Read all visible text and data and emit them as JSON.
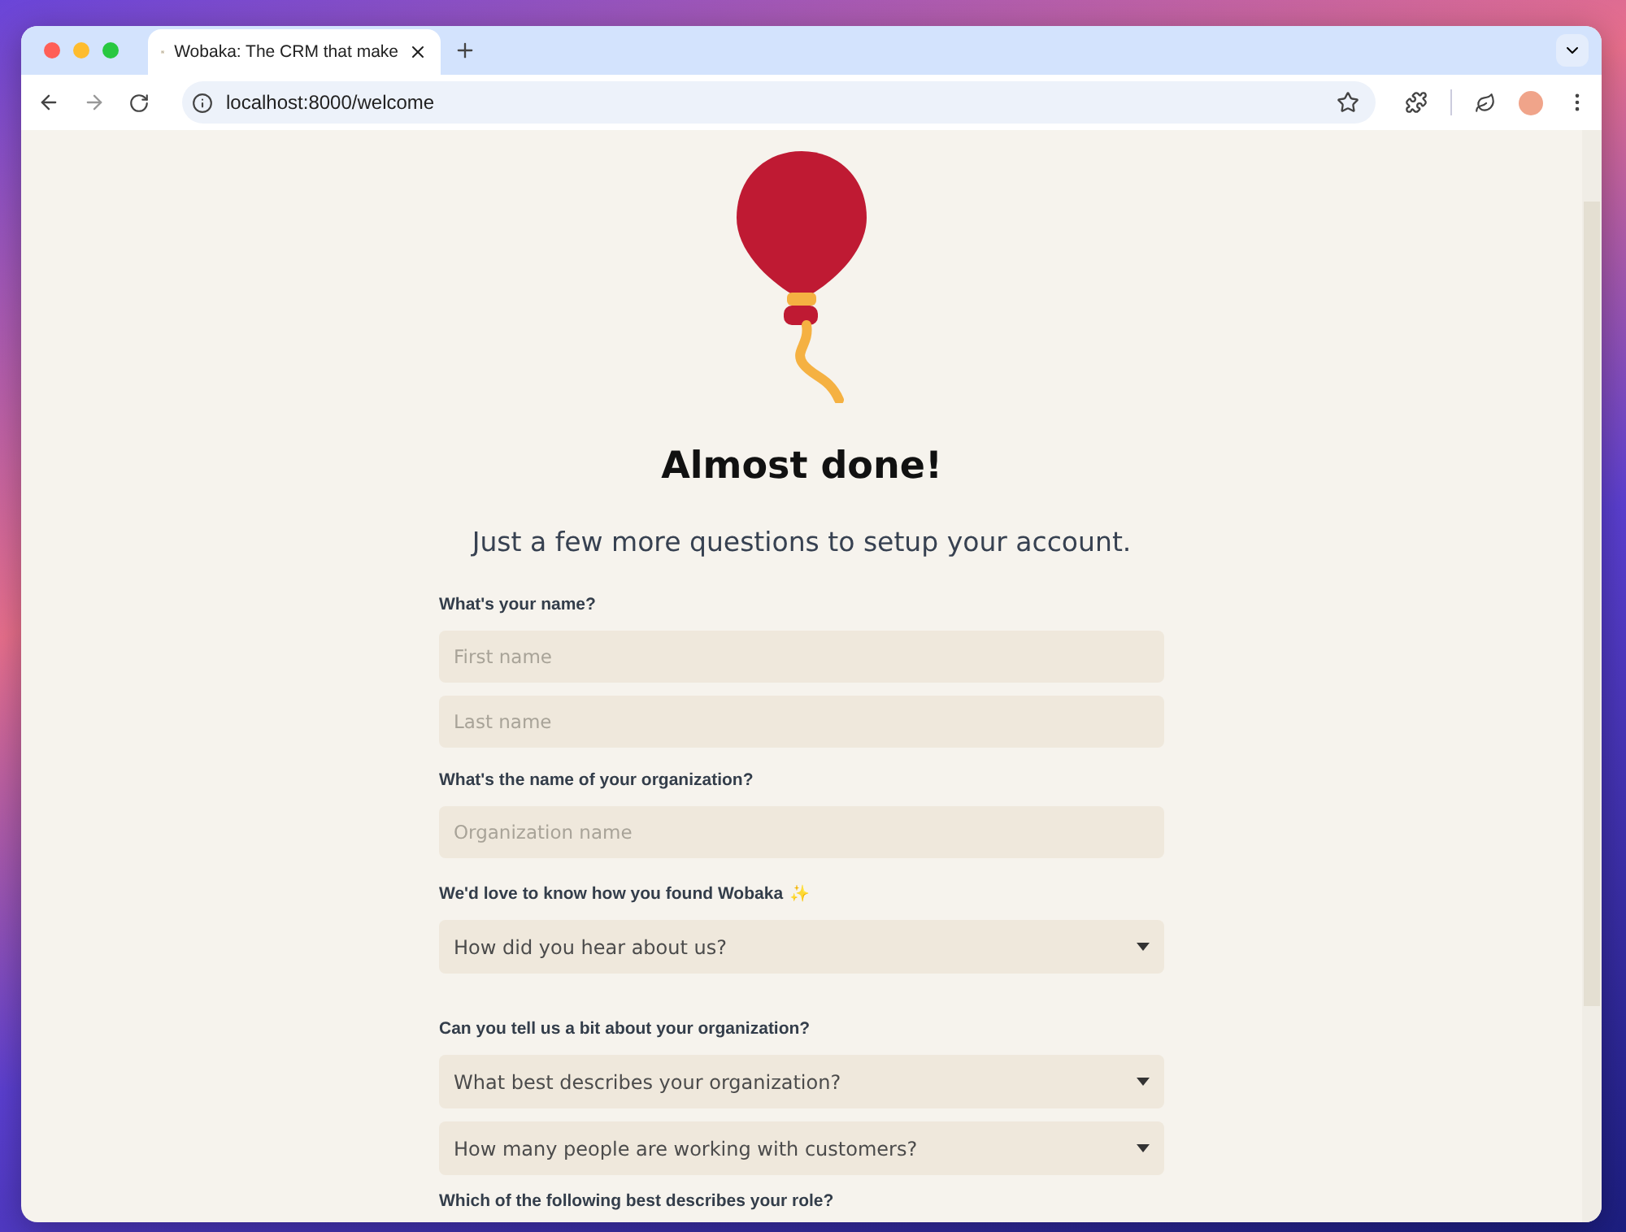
{
  "browser": {
    "tabs": [
      {
        "title": "Wobaka: The CRM that make",
        "selected": true
      }
    ],
    "url": "localhost:8000/welcome"
  },
  "page": {
    "heading": "Almost done!",
    "subtitle": "Just a few more questions to setup your account.",
    "sections": [
      {
        "label": "What's your name?",
        "fields": [
          {
            "kind": "text",
            "placeholder": "First name"
          },
          {
            "kind": "text",
            "placeholder": "Last name"
          }
        ]
      },
      {
        "label": "What's the name of your organization?",
        "fields": [
          {
            "kind": "text",
            "placeholder": "Organization name"
          }
        ]
      },
      {
        "label": "We'd love to know how you found Wobaka",
        "icon": "✨",
        "fields": [
          {
            "kind": "select",
            "placeholder": "How did you hear about us?"
          }
        ]
      },
      {
        "label": "Can you tell us a bit about your organization?",
        "fields": [
          {
            "kind": "select",
            "placeholder": "What best describes your organization?"
          },
          {
            "kind": "select",
            "placeholder": "How many people are working with customers?"
          }
        ]
      },
      {
        "label": "Which of the following best describes your role?"
      }
    ]
  }
}
